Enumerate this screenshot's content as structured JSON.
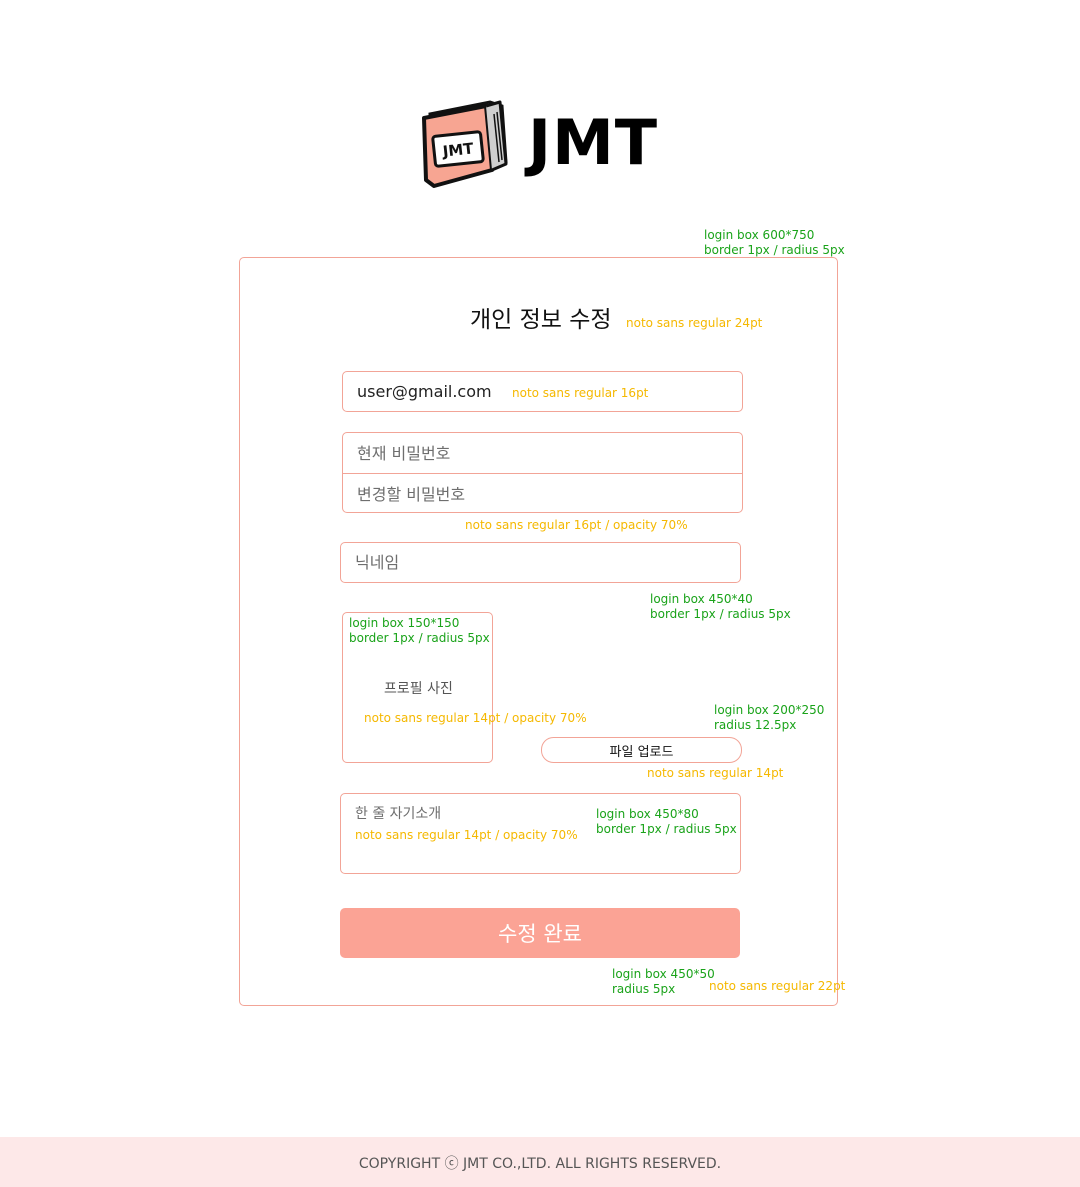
{
  "brand": {
    "logo_text": "JMT",
    "book_label": "JMT",
    "accent": "#fba395",
    "border": "#f2a497"
  },
  "annotations": {
    "box_main": [
      "login box 600*750",
      "border 1px / radius 5px"
    ],
    "title_font": "noto sans regular 24pt",
    "email_font": "noto sans regular 16pt",
    "password_font": "noto sans regular 16pt / opacity 70%",
    "input_box": [
      "login box 450*40",
      "border 1px / radius 5px"
    ],
    "profile_box": [
      "login box 150*150",
      "border 1px / radius 5px"
    ],
    "profile_font": "noto sans regular 14pt / opacity 70%",
    "upload_box": [
      "login box 200*250",
      "radius 12.5px"
    ],
    "upload_font": "noto sans regular 14pt",
    "intro_font": "noto sans regular 14pt / opacity 70%",
    "intro_box": [
      "login box 450*80",
      "border 1px / radius 5px"
    ],
    "submit_box": [
      "login box 450*50",
      "radius 5px"
    ],
    "submit_font": "noto sans regular 22pt"
  },
  "form": {
    "title": "개인 정보 수정",
    "email_value": "user@gmail.com",
    "current_password_placeholder": "현재 비밀번호",
    "new_password_placeholder": "변경할 비밀번호",
    "nickname_placeholder": "닉네임",
    "profile_photo_label": "프로필 사진",
    "upload_button": "파일 업로드",
    "intro_placeholder": "한 줄 자기소개",
    "submit_button": "수정 완료"
  },
  "footer": {
    "copyright": "COPYRIGHT ⓒ JMT CO.,LTD. ALL RIGHTS RESERVED."
  }
}
